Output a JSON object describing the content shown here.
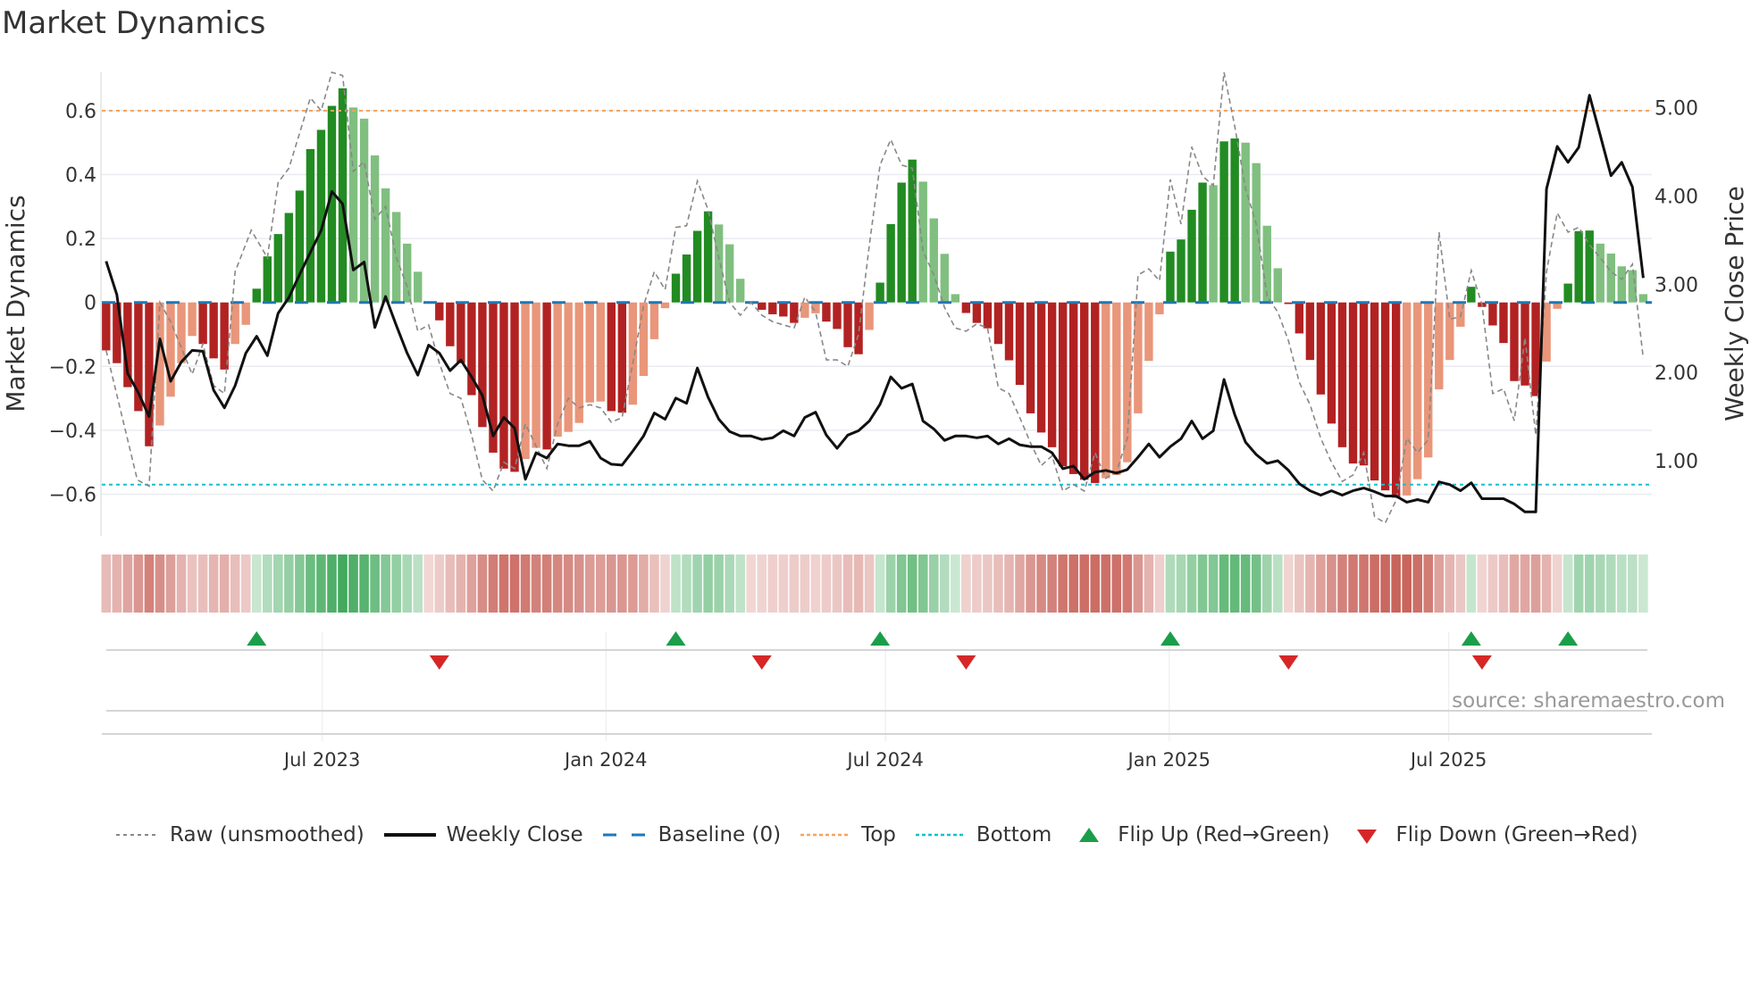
{
  "chart_data": {
    "type": "bar",
    "title": "Market Dynamics",
    "ylabel_left": "Market Dynamics",
    "ylabel_right": "Weekly Close Price",
    "ylim_left": [
      -0.73,
      0.72
    ],
    "ylim_right": [
      0.15,
      5.4
    ],
    "xlim_weeks": [
      -0.4,
      143.8
    ],
    "yticks_left": [
      {
        "v": 0.6,
        "label": "0.6"
      },
      {
        "v": 0.4,
        "label": "0.4"
      },
      {
        "v": 0.2,
        "label": "0.2"
      },
      {
        "v": 0,
        "label": "0"
      },
      {
        "v": -0.2,
        "label": "−0.2"
      },
      {
        "v": -0.4,
        "label": "−0.4"
      },
      {
        "v": -0.6,
        "label": "−0.6"
      }
    ],
    "yticks_right": [
      {
        "v": 5,
        "label": "5.00"
      },
      {
        "v": 4,
        "label": "4.00"
      },
      {
        "v": 3,
        "label": "3.00"
      },
      {
        "v": 2,
        "label": "2.00"
      },
      {
        "v": 1,
        "label": "1.00"
      }
    ],
    "xticks": [
      {
        "week": 20.1,
        "label": "Jul 2023"
      },
      {
        "week": 46.5,
        "label": "Jan 2024"
      },
      {
        "week": 72.5,
        "label": "Jul 2024"
      },
      {
        "week": 98.9,
        "label": "Jan 2025"
      },
      {
        "week": 124.9,
        "label": "Jul 2025"
      }
    ],
    "top_level": 0.6,
    "bottom_level": -0.57,
    "baseline": 0,
    "colors": {
      "up_strong": "#228b22",
      "up_weak": "#80bf80",
      "down_strong": "#b22222",
      "down_weak": "#e9967a",
      "top": "#f4a460",
      "bottom": "#17becf",
      "baseline": "#1f77b4",
      "raw": "#888888",
      "close": "#111111",
      "flip_up": "#1a9e4a",
      "flip_down": "#d62728"
    },
    "hist": [
      -0.15,
      -0.19,
      -0.265,
      -0.34,
      -0.45,
      -0.385,
      -0.295,
      -0.19,
      -0.105,
      -0.13,
      -0.175,
      -0.21,
      -0.13,
      -0.07,
      0.043,
      0.144,
      0.214,
      0.28,
      0.35,
      0.48,
      0.54,
      0.615,
      0.67,
      0.61,
      0.575,
      0.46,
      0.357,
      0.283,
      0.184,
      0.096,
      0,
      -0.056,
      -0.137,
      -0.19,
      -0.29,
      -0.39,
      -0.47,
      -0.52,
      -0.53,
      -0.49,
      -0.455,
      -0.46,
      -0.42,
      -0.405,
      -0.377,
      -0.313,
      -0.31,
      -0.34,
      -0.345,
      -0.32,
      -0.23,
      -0.115,
      -0.018,
      0.09,
      0.15,
      0.224,
      0.285,
      0.244,
      0.182,
      0.074,
      0,
      -0.023,
      -0.037,
      -0.044,
      -0.064,
      -0.048,
      -0.034,
      -0.06,
      -0.083,
      -0.14,
      -0.162,
      -0.086,
      0.062,
      0.245,
      0.375,
      0.447,
      0.378,
      0.263,
      0.152,
      0.026,
      -0.033,
      -0.064,
      -0.081,
      -0.13,
      -0.181,
      -0.258,
      -0.347,
      -0.407,
      -0.453,
      -0.513,
      -0.537,
      -0.555,
      -0.565,
      -0.55,
      -0.54,
      -0.5,
      -0.347,
      -0.183,
      -0.037,
      0.159,
      0.197,
      0.29,
      0.375,
      0.367,
      0.504,
      0.513,
      0.5,
      0.436,
      0.24,
      0.107,
      -0.005,
      -0.097,
      -0.18,
      -0.288,
      -0.379,
      -0.453,
      -0.504,
      -0.51,
      -0.557,
      -0.588,
      -0.611,
      -0.604,
      -0.553,
      -0.485,
      -0.272,
      -0.18,
      -0.076,
      0.049,
      -0.014,
      -0.072,
      -0.127,
      -0.246,
      -0.26,
      -0.293,
      -0.185,
      -0.02,
      0.059,
      0.223,
      0.225,
      0.184,
      0.153,
      0.113,
      0.101,
      0.026
    ],
    "close": [
      3.26,
      2.88,
      1.99,
      1.77,
      1.5,
      2.38,
      1.9,
      2.12,
      2.25,
      2.24,
      1.8,
      1.6,
      1.85,
      2.22,
      2.41,
      2.19,
      2.67,
      2.85,
      3.11,
      3.36,
      3.61,
      4.05,
      3.91,
      3.16,
      3.25,
      2.51,
      2.86,
      2.53,
      2.22,
      1.97,
      2.31,
      2.22,
      2.02,
      2.14,
      1.95,
      1.74,
      1.28,
      1.49,
      1.37,
      0.79,
      1.09,
      1.03,
      1.19,
      1.17,
      1.17,
      1.22,
      1.03,
      0.96,
      0.95,
      1.11,
      1.28,
      1.54,
      1.47,
      1.71,
      1.65,
      2.05,
      1.72,
      1.47,
      1.33,
      1.28,
      1.28,
      1.24,
      1.26,
      1.34,
      1.28,
      1.49,
      1.55,
      1.29,
      1.14,
      1.29,
      1.34,
      1.45,
      1.64,
      1.95,
      1.82,
      1.87,
      1.45,
      1.36,
      1.23,
      1.28,
      1.28,
      1.26,
      1.28,
      1.19,
      1.25,
      1.18,
      1.16,
      1.16,
      1.09,
      0.91,
      0.94,
      0.79,
      0.87,
      0.89,
      0.86,
      0.9,
      1.04,
      1.19,
      1.04,
      1.16,
      1.25,
      1.45,
      1.25,
      1.34,
      1.92,
      1.52,
      1.21,
      1.07,
      0.97,
      1.0,
      0.89,
      0.74,
      0.66,
      0.61,
      0.66,
      0.61,
      0.66,
      0.69,
      0.65,
      0.6,
      0.6,
      0.53,
      0.56,
      0.53,
      0.76,
      0.73,
      0.66,
      0.75,
      0.57,
      0.57,
      0.57,
      0.51,
      0.42,
      0.42,
      4.08,
      4.56,
      4.38,
      4.55,
      5.14,
      4.69,
      4.23,
      4.38,
      4.1,
      3.07
    ],
    "raw_points": [
      [
        0,
        -0.15
      ],
      [
        2.9,
        -0.555
      ],
      [
        4,
        -0.575
      ],
      [
        5,
        0.0
      ],
      [
        6,
        -0.06
      ],
      [
        8,
        -0.225
      ],
      [
        9,
        -0.13
      ],
      [
        10,
        -0.26
      ],
      [
        11,
        -0.285
      ],
      [
        12,
        0.096
      ],
      [
        13.5,
        0.226
      ],
      [
        15,
        0.14
      ],
      [
        16,
        0.375
      ],
      [
        17,
        0.42
      ],
      [
        19,
        0.64
      ],
      [
        20,
        0.6
      ],
      [
        21,
        0.72
      ],
      [
        22,
        0.71
      ],
      [
        23,
        0.41
      ],
      [
        24,
        0.44
      ],
      [
        25,
        0.26
      ],
      [
        26,
        0.3
      ],
      [
        27,
        0.14
      ],
      [
        28,
        0.05
      ],
      [
        29,
        -0.09
      ],
      [
        30,
        -0.07
      ],
      [
        31,
        -0.19
      ],
      [
        32,
        -0.285
      ],
      [
        33,
        -0.3
      ],
      [
        34,
        -0.415
      ],
      [
        35,
        -0.555
      ],
      [
        36,
        -0.59
      ],
      [
        37,
        -0.5
      ],
      [
        38,
        -0.52
      ],
      [
        39,
        -0.38
      ],
      [
        41,
        -0.52
      ],
      [
        42,
        -0.38
      ],
      [
        43,
        -0.3
      ],
      [
        44,
        -0.33
      ],
      [
        45,
        -0.32
      ],
      [
        46,
        -0.33
      ],
      [
        47,
        -0.375
      ],
      [
        48,
        -0.36
      ],
      [
        49,
        -0.19
      ],
      [
        50,
        -0.01
      ],
      [
        51,
        0.096
      ],
      [
        52,
        0.04
      ],
      [
        53,
        0.235
      ],
      [
        54,
        0.24
      ],
      [
        55,
        0.38
      ],
      [
        56,
        0.29
      ],
      [
        57,
        0.14
      ],
      [
        58,
        0.0
      ],
      [
        59,
        -0.04
      ],
      [
        60,
        0.0
      ],
      [
        61,
        -0.04
      ],
      [
        62,
        -0.06
      ],
      [
        63,
        -0.07
      ],
      [
        64,
        -0.08
      ],
      [
        65,
        0.017
      ],
      [
        66,
        -0.03
      ],
      [
        67,
        -0.18
      ],
      [
        68,
        -0.18
      ],
      [
        69,
        -0.2
      ],
      [
        70,
        -0.1
      ],
      [
        71,
        0.18
      ],
      [
        72,
        0.43
      ],
      [
        73,
        0.51
      ],
      [
        74,
        0.43
      ],
      [
        75,
        0.42
      ],
      [
        76,
        0.16
      ],
      [
        77,
        0.086
      ],
      [
        78,
        -0.016
      ],
      [
        79,
        -0.08
      ],
      [
        80,
        -0.09
      ],
      [
        81,
        -0.067
      ],
      [
        82,
        -0.08
      ],
      [
        83,
        -0.267
      ],
      [
        84,
        -0.285
      ],
      [
        85,
        -0.36
      ],
      [
        86,
        -0.44
      ],
      [
        87,
        -0.51
      ],
      [
        88,
        -0.48
      ],
      [
        89,
        -0.59
      ],
      [
        90,
        -0.57
      ],
      [
        91,
        -0.59
      ],
      [
        92,
        -0.47
      ],
      [
        93,
        -0.55
      ],
      [
        94,
        -0.53
      ],
      [
        95,
        -0.425
      ],
      [
        96,
        0.086
      ],
      [
        97,
        0.105
      ],
      [
        98,
        0.068
      ],
      [
        99,
        0.385
      ],
      [
        100,
        0.245
      ],
      [
        101,
        0.487
      ],
      [
        102,
        0.395
      ],
      [
        103,
        0.366
      ],
      [
        104,
        0.72
      ],
      [
        105,
        0.55
      ],
      [
        106,
        0.356
      ],
      [
        107,
        0.245
      ],
      [
        108,
        0.02
      ],
      [
        109,
        -0.03
      ],
      [
        110,
        -0.12
      ],
      [
        111,
        -0.25
      ],
      [
        112,
        -0.32
      ],
      [
        113,
        -0.425
      ],
      [
        114,
        -0.5
      ],
      [
        115,
        -0.56
      ],
      [
        116,
        -0.54
      ],
      [
        117,
        -0.47
      ],
      [
        118,
        -0.67
      ],
      [
        119,
        -0.69
      ],
      [
        120,
        -0.62
      ],
      [
        121,
        -0.425
      ],
      [
        122,
        -0.47
      ],
      [
        123,
        -0.43
      ],
      [
        124,
        0.22
      ],
      [
        125,
        -0.053
      ],
      [
        126,
        -0.044
      ],
      [
        127,
        0.1
      ],
      [
        128,
        -0.007
      ],
      [
        129,
        -0.285
      ],
      [
        130,
        -0.27
      ],
      [
        131,
        -0.37
      ],
      [
        132,
        -0.11
      ],
      [
        133,
        -0.415
      ],
      [
        134,
        0.096
      ],
      [
        135,
        0.28
      ],
      [
        136,
        0.22
      ],
      [
        137,
        0.235
      ],
      [
        138,
        0.18
      ],
      [
        139,
        0.14
      ],
      [
        140,
        0.096
      ],
      [
        141,
        0.072
      ],
      [
        142,
        0.12
      ],
      [
        143,
        -0.175
      ]
    ],
    "legend": [
      "Raw (unsmoothed)",
      "Weekly Close",
      "Baseline (0)",
      "Top",
      "Bottom",
      "Flip Up (Red→Green)",
      "Flip Down (Green→Red)"
    ],
    "legend_placement": "bottom-center",
    "source": "source: sharemaestro.com"
  }
}
